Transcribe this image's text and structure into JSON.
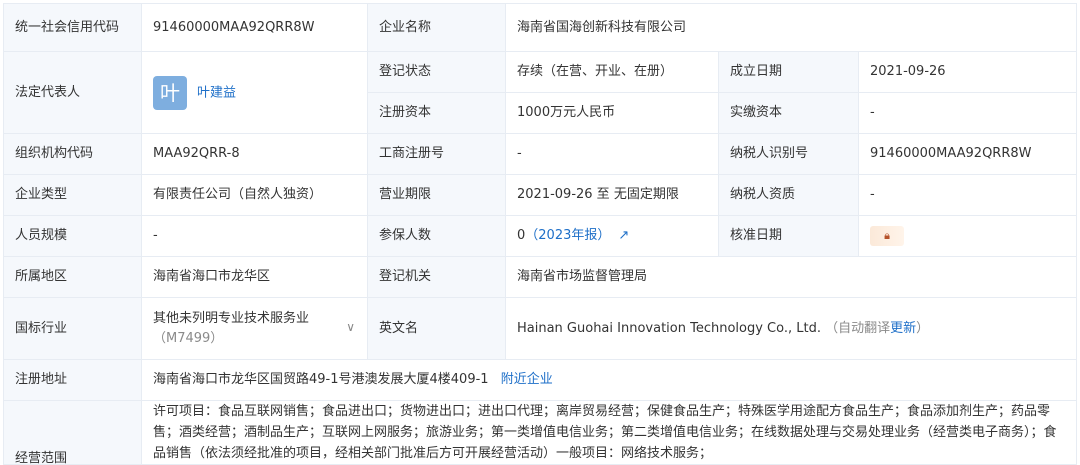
{
  "credit_code": {
    "label": "统一社会信用代码",
    "value": "91460000MAA92QRR8W"
  },
  "company_name": {
    "label": "企业名称",
    "value": "海南省国海创新科技有限公司"
  },
  "legal_rep": {
    "label": "法定代表人",
    "avatar_char": "叶",
    "name": "叶建益"
  },
  "reg_status": {
    "label": "登记状态",
    "value": "存续（在营、开业、在册）"
  },
  "founded": {
    "label": "成立日期",
    "value": "2021-09-26"
  },
  "reg_capital": {
    "label": "注册资本",
    "value": "1000万元人民币"
  },
  "paid_capital": {
    "label": "实缴资本",
    "value": "-"
  },
  "org_code": {
    "label": "组织机构代码",
    "value": "MAA92QRR-8"
  },
  "biz_reg_no": {
    "label": "工商注册号",
    "value": "-"
  },
  "taxpayer_id": {
    "label": "纳税人识别号",
    "value": "91460000MAA92QRR8W"
  },
  "company_type": {
    "label": "企业类型",
    "value": "有限责任公司（自然人独资）"
  },
  "biz_term": {
    "label": "营业期限",
    "value": "2021-09-26 至 无固定期限"
  },
  "taxpayer_qual": {
    "label": "纳税人资质",
    "value": "-"
  },
  "staff_size": {
    "label": "人员规模",
    "value": "-"
  },
  "insured": {
    "label": "参保人数",
    "value": "0",
    "report": "（2023年报）"
  },
  "approval_date": {
    "label": "核准日期"
  },
  "region": {
    "label": "所属地区",
    "value": "海南省海口市龙华区"
  },
  "reg_authority": {
    "label": "登记机关",
    "value": "海南省市场监督管理局"
  },
  "industry": {
    "label": "国标行业",
    "value": "其他未列明专业技术服务业",
    "code": "（M7499）"
  },
  "english_name": {
    "label": "英文名",
    "value": "Hainan Guohai Innovation Technology Co., Ltd.",
    "auto": "（自动翻译",
    "update": "更新",
    "close": "）"
  },
  "address": {
    "label": "注册地址",
    "value": "海南省海口市龙华区国贸路49-1号港澳发展大厦4楼409-1",
    "nearby": "附近企业"
  },
  "scope": {
    "label": "经营范围",
    "text": "许可项目：食品互联网销售；食品进出口；货物进出口；进出口代理；离岸贸易经营；保健食品生产；特殊医学用途配方食品生产；食品添加剂生产；药品零售；酒类经营；酒制品生产；互联网上网服务；旅游业务；第一类增值电信业务；第二类增值电信业务；在线数据处理与交易处理业务（经营类电子商务）；食品销售（依法须经批准的项目，经相关部门批准后方可开展经营活动）一般项目：网络技术服务；"
  }
}
